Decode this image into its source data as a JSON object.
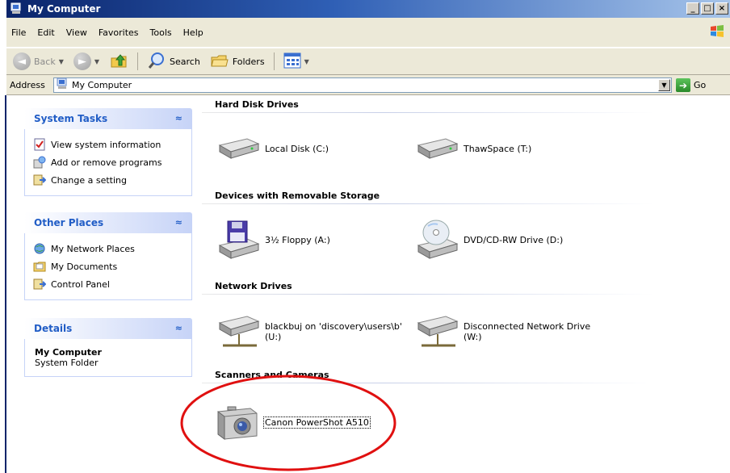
{
  "window": {
    "title": "My Computer",
    "controls": {
      "minimize": "_",
      "maximize": "□",
      "close": "×"
    }
  },
  "menu": {
    "items": [
      "File",
      "Edit",
      "View",
      "Favorites",
      "Tools",
      "Help"
    ]
  },
  "toolbar": {
    "back_label": "Back",
    "search_label": "Search",
    "folders_label": "Folders"
  },
  "address": {
    "label": "Address",
    "value": "My Computer",
    "go_label": "Go"
  },
  "taskpane": {
    "system_tasks": {
      "title": "System Tasks",
      "links": [
        "View system information",
        "Add or remove programs",
        "Change a setting"
      ]
    },
    "other_places": {
      "title": "Other Places",
      "links": [
        "My Network Places",
        "My Documents",
        "Control Panel"
      ]
    },
    "details": {
      "title": "Details",
      "name": "My Computer",
      "type": "System Folder"
    }
  },
  "groups": {
    "hard_disk": {
      "title": "Hard Disk Drives",
      "items": [
        "Local Disk (C:)",
        "ThawSpace (T:)"
      ]
    },
    "removable": {
      "title": "Devices with Removable Storage",
      "items": [
        "3½ Floppy (A:)",
        "DVD/CD-RW Drive (D:)"
      ]
    },
    "network": {
      "title": "Network Drives",
      "items": [
        {
          "line1": "blackbuj on 'discovery\\users\\b'",
          "line2": "(U:)"
        },
        {
          "line1": "Disconnected Network Drive",
          "line2": "(W:)"
        }
      ]
    },
    "scanners": {
      "title": "Scanners and Cameras",
      "items": [
        "Canon PowerShot A510"
      ]
    }
  },
  "colors": {
    "titlebar": "#0a246a",
    "panel_header_text": "#215dc6",
    "annotation": "#e01010"
  }
}
